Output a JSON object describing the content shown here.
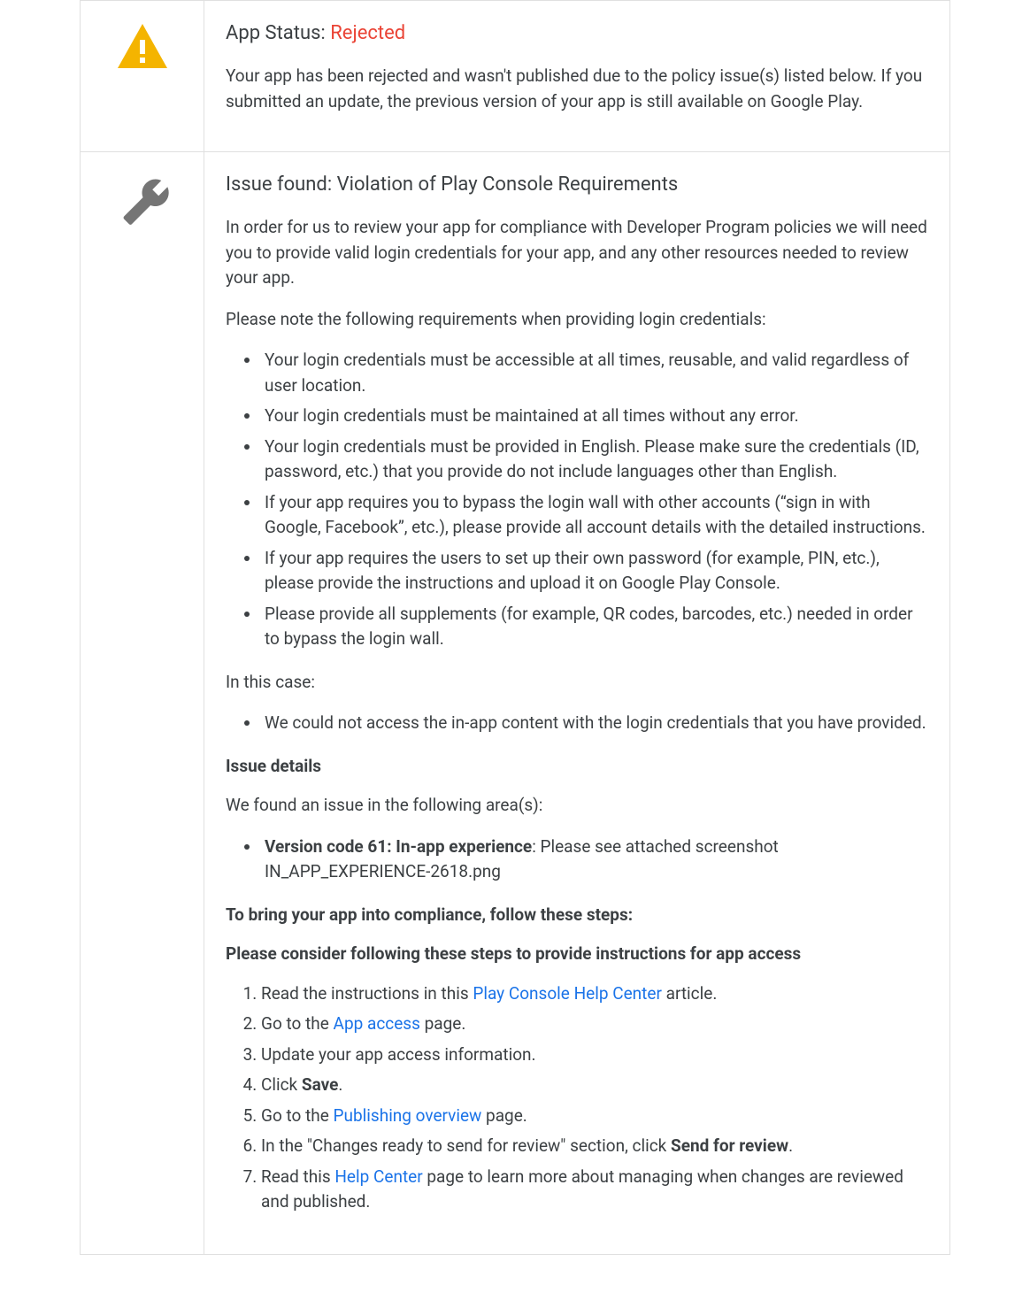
{
  "status": {
    "label_prefix": "App Status: ",
    "value": "Rejected",
    "paragraph": "Your app has been rejected and wasn't published due to the policy issue(s) listed below. If you submitted an update, the previous version of your app is still available on Google Play."
  },
  "issue": {
    "title": "Issue found: Violation of Play Console Requirements",
    "intro": "In order for us to review your app for compliance with Developer Program policies we will need you to provide valid login credentials for your app, and any other resources needed to review your app.",
    "note_lead": "Please note the following requirements when providing login credentials:",
    "requirements": [
      "Your login credentials must be accessible at all times, reusable, and valid regardless of user location.",
      "Your login credentials must be maintained at all times without any error.",
      "Your login credentials must be provided in English. Please make sure the credentials (ID, password, etc.) that you provide do not include languages other than English.",
      "If your app requires you to bypass the login wall with other accounts (“sign in with Google, Facebook”, etc.), please provide all account details with the detailed instructions.",
      "If your app requires the users to set up their own password (for example, PIN, etc.), please provide the instructions and upload it on Google Play Console.",
      "Please provide all supplements (for example, QR codes, barcodes, etc.) needed in order to bypass the login wall."
    ],
    "in_this_case_label": "In this case:",
    "in_this_case_item": "We could not access the in-app content with the login credentials that you have provided.",
    "details_heading": "Issue details",
    "details_lead": "We found an issue in the following area(s):",
    "details_item_bold": "Version code 61: In-app experience",
    "details_item_rest": ": Please see attached screenshot IN_APP_EXPERIENCE-2618.png",
    "compliance_heading": "To bring your app into compliance, follow these steps:",
    "consider_heading": "Please consider following these steps to provide instructions for app access",
    "steps": {
      "s1_pre": "Read the instructions in this ",
      "s1_link": "Play Console Help Center",
      "s1_post": " article.",
      "s2_pre": "Go to the ",
      "s2_link": "App access",
      "s2_post": " page.",
      "s3": "Update your app access information.",
      "s4_pre": "Click ",
      "s4_bold": "Save",
      "s4_post": ".",
      "s5_pre": "Go to the ",
      "s5_link": "Publishing overview",
      "s5_post": " page.",
      "s6_pre": "In the \"Changes ready to send for review\" section, click ",
      "s6_bold": "Send for review",
      "s6_post": ".",
      "s7_pre": "Read this ",
      "s7_link": "Help Center",
      "s7_post": " page to learn more about managing when changes are reviewed and published."
    }
  }
}
